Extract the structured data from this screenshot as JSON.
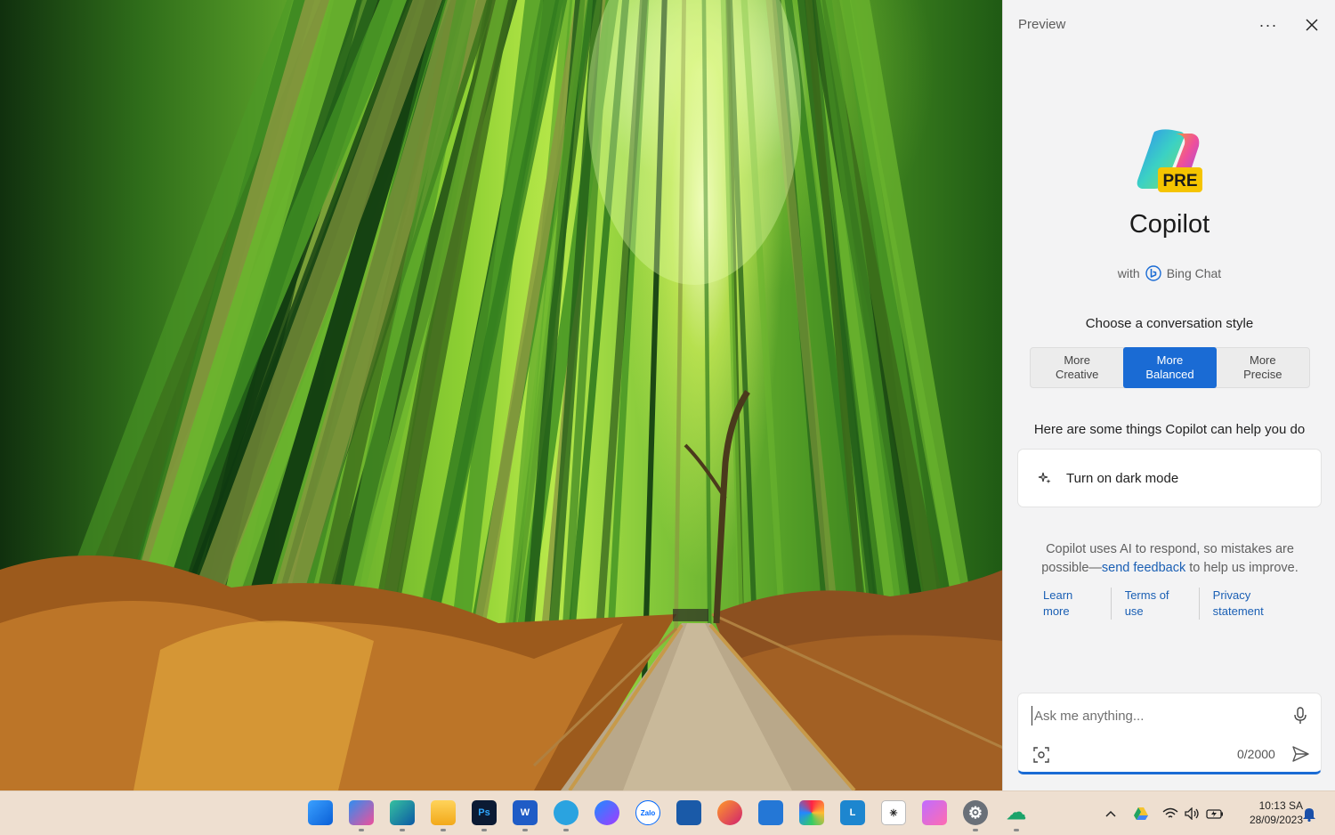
{
  "wallpaper": {
    "description_icon": "bamboo-forest-wallpaper"
  },
  "copilot": {
    "pane_title": "Preview",
    "more_label": "···",
    "logo_badge": "PRE",
    "brand_title": "Copilot",
    "with_label": "with",
    "bing_label": "Bing Chat",
    "style_heading": "Choose a conversation style",
    "styles": [
      {
        "line1": "More",
        "line2": "Creative",
        "active": false
      },
      {
        "line1": "More",
        "line2": "Balanced",
        "active": true
      },
      {
        "line1": "More",
        "line2": "Precise",
        "active": false
      }
    ],
    "help_heading": "Here are some things Copilot can help you do",
    "suggestion": "Turn on dark mode",
    "disclaimer_before": "Copilot uses AI to respond, so mistakes are possible—",
    "disclaimer_link": "send feedback",
    "disclaimer_after": " to help us improve.",
    "legal_links": [
      "Learn more",
      "Terms of use",
      "Privacy statement"
    ],
    "input_placeholder": "Ask me anything...",
    "char_count": "0/2000",
    "accent_color": "#1a6bd4"
  },
  "taskbar": {
    "apps": [
      {
        "name": "start-icon"
      },
      {
        "name": "copilot-icon"
      },
      {
        "name": "edge-icon"
      },
      {
        "name": "file-explorer-icon"
      },
      {
        "name": "photoshop-icon"
      },
      {
        "name": "word-icon"
      },
      {
        "name": "telegram-icon"
      },
      {
        "name": "messenger-icon"
      },
      {
        "name": "zalo-icon"
      },
      {
        "name": "microsoft-store-icon"
      },
      {
        "name": "firefox-icon"
      },
      {
        "name": "mail-icon"
      },
      {
        "name": "photos-icon"
      },
      {
        "name": "l-app-icon"
      },
      {
        "name": "chatgpt-icon"
      },
      {
        "name": "paint-icon"
      },
      {
        "name": "settings-icon"
      },
      {
        "name": "cloud-upload-icon"
      }
    ],
    "time": "10:13 SA",
    "date": "28/09/2023"
  }
}
